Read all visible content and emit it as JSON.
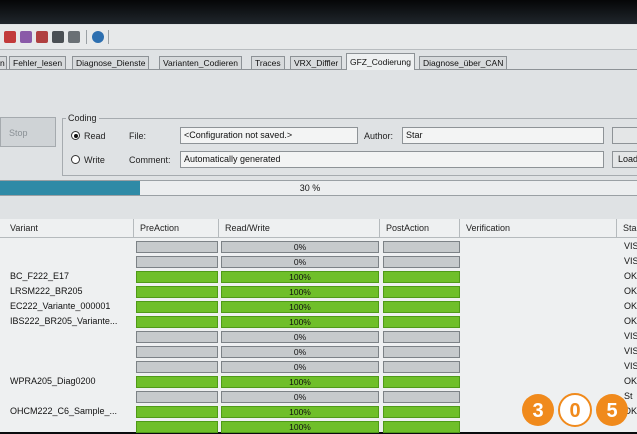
{
  "tabs": [
    "n",
    "Fehler_lesen",
    "Diagnose_Dienste",
    "Varianten_Codieren",
    "Traces",
    "VRX_Diffler",
    "GFZ_Codierung",
    "Diagnose_über_CAN"
  ],
  "active_tab": "GFZ_Codierung",
  "stop_label": "Stop",
  "coding": {
    "title": "Coding",
    "read_label": "Read",
    "write_label": "Write",
    "mode": "Read",
    "file_label": "File:",
    "file_value": "<Configuration not saved.>",
    "author_label": "Author:",
    "author_value": "Star",
    "comment_label": "Comment:",
    "comment_value": "Automatically generated",
    "load_label": "Load"
  },
  "progress": {
    "percent": 30,
    "label": "30 %"
  },
  "table": {
    "headers": {
      "variant": "Variant",
      "pre": "PreAction",
      "rw": "Read/Write",
      "post": "PostAction",
      "verification": "Verification",
      "status": "Sta"
    },
    "rows": [
      {
        "variant": "",
        "pct": "0%",
        "done": false,
        "status": "VIS"
      },
      {
        "variant": "",
        "pct": "0%",
        "done": false,
        "status": "VIS"
      },
      {
        "variant": "BC_F222_E17",
        "pct": "100%",
        "done": true,
        "status": "OK"
      },
      {
        "variant": "LRSM222_BR205",
        "pct": "100%",
        "done": true,
        "status": "OK"
      },
      {
        "variant": "EC222_Variante_000001",
        "pct": "100%",
        "done": true,
        "status": "OK"
      },
      {
        "variant": "IBS222_BR205_Variante...",
        "pct": "100%",
        "done": true,
        "status": "OK"
      },
      {
        "variant": "",
        "pct": "0%",
        "done": false,
        "status": "VIS"
      },
      {
        "variant": "",
        "pct": "0%",
        "done": false,
        "status": "VIS"
      },
      {
        "variant": "",
        "pct": "0%",
        "done": false,
        "status": "VIS"
      },
      {
        "variant": "WPRA205_Diag0200",
        "pct": "100%",
        "done": true,
        "status": "OK"
      },
      {
        "variant": "",
        "pct": "0%",
        "done": false,
        "status": "St"
      },
      {
        "variant": "OHCM222_C6_Sample_...",
        "pct": "100%",
        "done": true,
        "status": "OK"
      },
      {
        "variant": "",
        "pct": "100%",
        "done": true,
        "status": ""
      }
    ]
  },
  "watermark": "305",
  "colors": {
    "progress": "#2f8aa6",
    "done_bar": "#6fbf2a",
    "empty_bar": "#c6cacc",
    "logo_orange": "#f08a1c"
  }
}
